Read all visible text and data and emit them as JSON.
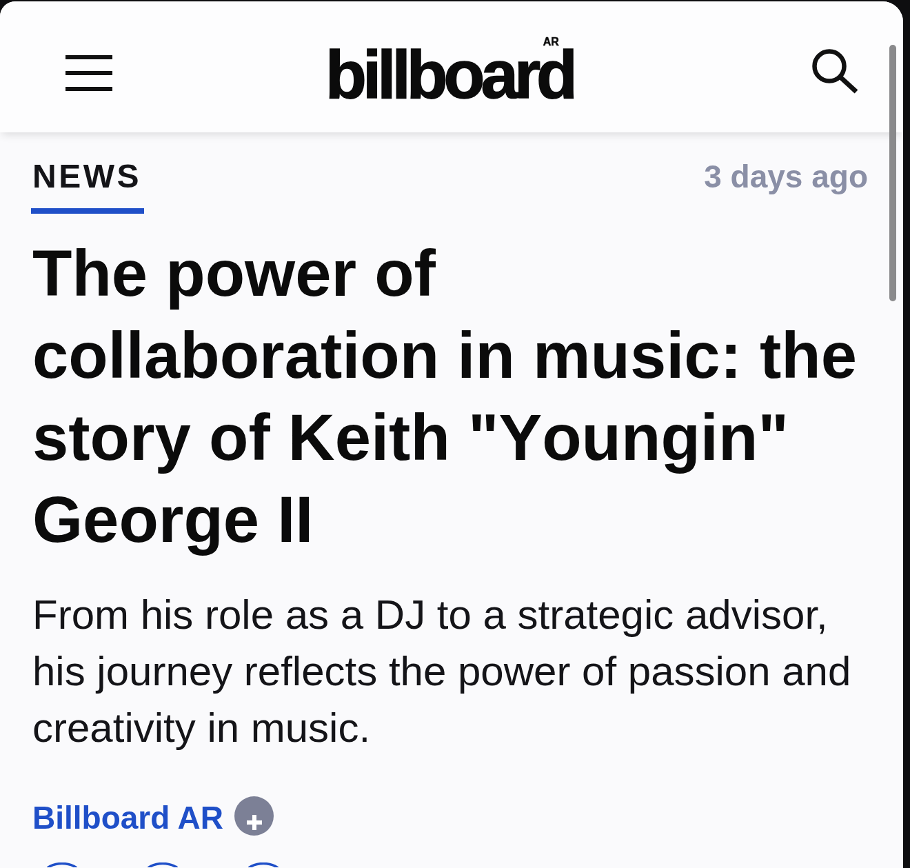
{
  "header": {
    "logo": {
      "wordmark": "billboard",
      "superscript": "AR"
    }
  },
  "article": {
    "category": "NEWS",
    "published": "3 days ago",
    "headline": "The power of collaboration in music: the story of Keith \"Youngin\" George II",
    "dek": "From his role as a DJ to a strategic advisor, his journey reflects the power of passion and creativity in music.",
    "author": "Billboard AR"
  }
}
